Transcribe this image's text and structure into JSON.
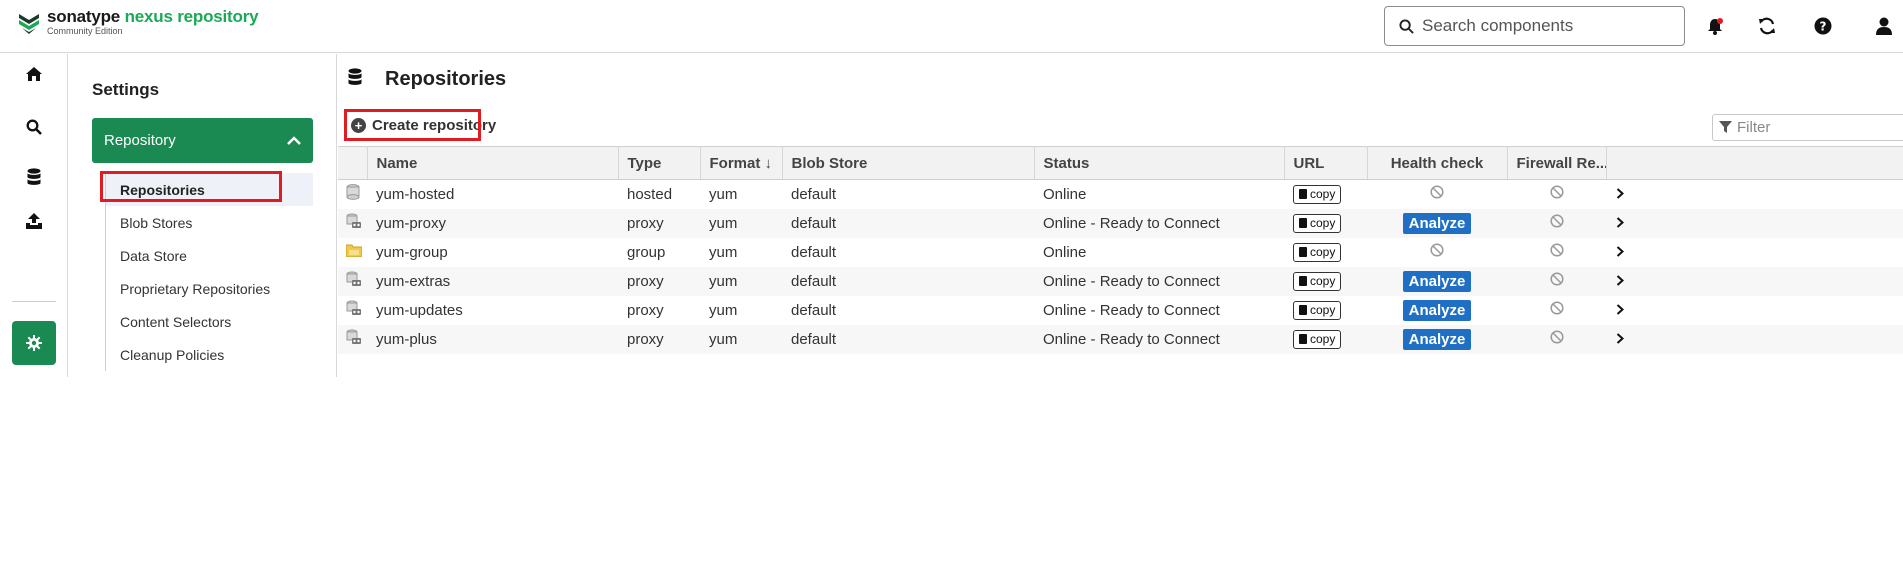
{
  "header": {
    "brand_name": "sonatype",
    "brand_product": "nexus repository",
    "brand_edition": "Community Edition",
    "search_placeholder": "Search components"
  },
  "rail": {
    "items": [
      "home-icon",
      "search-icon",
      "database-icon",
      "upload-icon",
      "gear-icon"
    ]
  },
  "settings": {
    "title": "Settings",
    "group_label": "Repository",
    "items": [
      {
        "label": "Repositories",
        "selected": true
      },
      {
        "label": "Blob Stores"
      },
      {
        "label": "Data Store"
      },
      {
        "label": "Proprietary Repositories"
      },
      {
        "label": "Content Selectors"
      },
      {
        "label": "Cleanup Policies"
      }
    ]
  },
  "main": {
    "title": "Repositories",
    "create_label": "Create repository",
    "filter_placeholder": "Filter"
  },
  "table": {
    "columns": [
      "Name",
      "Type",
      "Format ↓",
      "Blob Store",
      "Status",
      "URL",
      "Health check",
      "Firewall Re..."
    ],
    "copy_label": "copy",
    "analyze_label": "Analyze",
    "rows": [
      {
        "name": "yum-hosted",
        "type": "hosted",
        "format": "yum",
        "blob": "default",
        "status": "Online",
        "health": "none"
      },
      {
        "name": "yum-proxy",
        "type": "proxy",
        "format": "yum",
        "blob": "default",
        "status": "Online - Ready to Connect",
        "health": "analyze"
      },
      {
        "name": "yum-group",
        "type": "group",
        "format": "yum",
        "blob": "default",
        "status": "Online",
        "health": "none"
      },
      {
        "name": "yum-extras",
        "type": "proxy",
        "format": "yum",
        "blob": "default",
        "status": "Online - Ready to Connect",
        "health": "analyze"
      },
      {
        "name": "yum-updates",
        "type": "proxy",
        "format": "yum",
        "blob": "default",
        "status": "Online - Ready to Connect",
        "health": "analyze"
      },
      {
        "name": "yum-plus",
        "type": "proxy",
        "format": "yum",
        "blob": "default",
        "status": "Online - Ready to Connect",
        "health": "analyze"
      }
    ]
  },
  "colors": {
    "brand_green": "#1b8a52",
    "accent_green_text": "#1aaa55",
    "analyze_blue": "#1f6fc5",
    "highlight_red": "#e11b22"
  }
}
